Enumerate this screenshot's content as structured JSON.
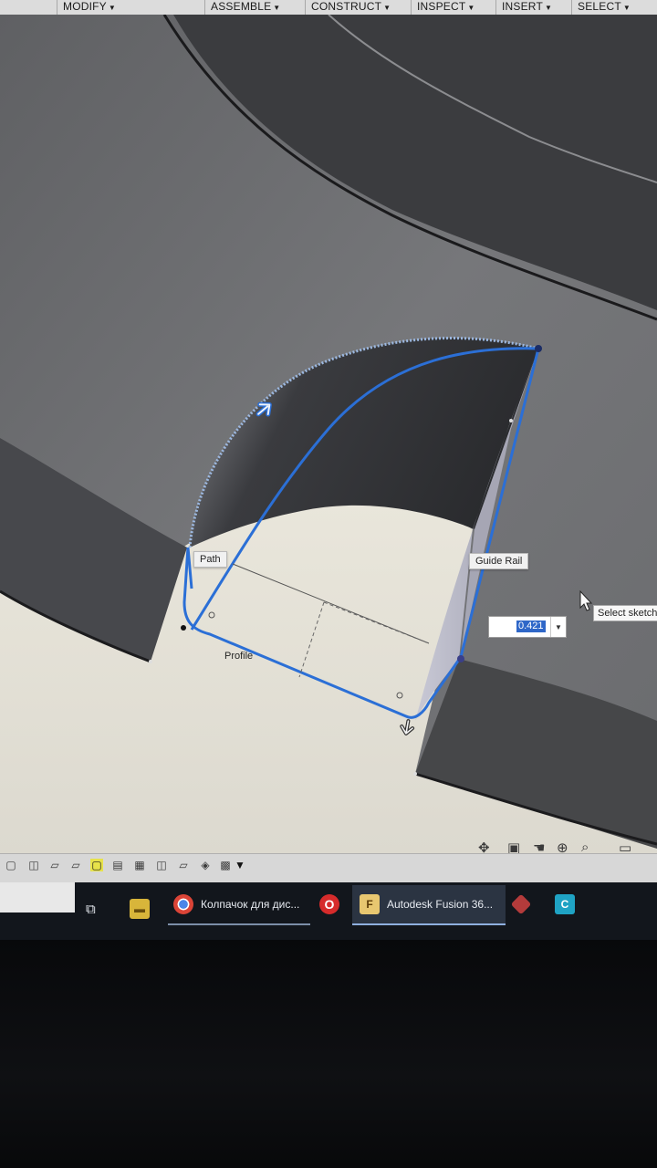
{
  "toolbar": {
    "menus": [
      {
        "label": "MODIFY"
      },
      {
        "label": "ASSEMBLE"
      },
      {
        "label": "CONSTRUCT"
      },
      {
        "label": "INSPECT"
      },
      {
        "label": "INSERT"
      },
      {
        "label": "SELECT"
      }
    ]
  },
  "viewport": {
    "labels": {
      "path": "Path",
      "profile": "Profile",
      "guide_rail": "Guide Rail"
    },
    "value_input": {
      "value": "0.421"
    },
    "tooltip": "Select sketch"
  },
  "taskbar": {
    "chrome_window": "Колпачок для дис...",
    "fusion_window": "Autodesk Fusion 36..."
  },
  "colors": {
    "sketch_blue": "#2b6fd6",
    "selection_highlight": "#2f67c8"
  },
  "icons": {
    "cursor": "mouse-pointer-icon",
    "path_direction": "arrow-up-right-icon",
    "profile_direction": "arrow-down-icon"
  }
}
